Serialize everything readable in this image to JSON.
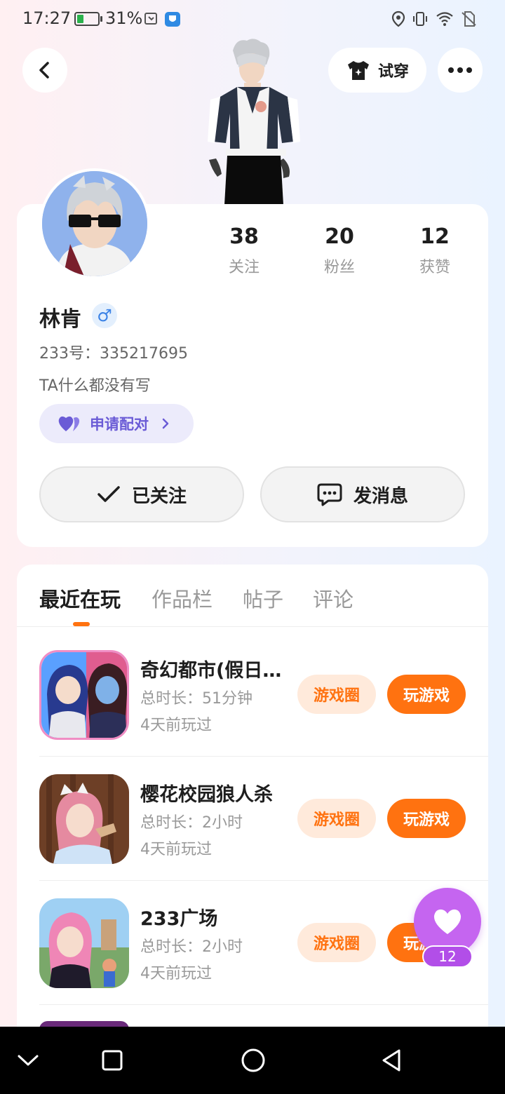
{
  "status_bar": {
    "time": "17:27",
    "battery_percent": "31%",
    "battery_level": 0.31
  },
  "header": {
    "try_on_label": "试穿"
  },
  "profile": {
    "stats": [
      {
        "value": "38",
        "label": "关注"
      },
      {
        "value": "20",
        "label": "粉丝"
      },
      {
        "value": "12",
        "label": "获赞"
      }
    ],
    "name": "林肯",
    "gender_symbol": "♂",
    "user_id": "233号：335217695",
    "bio": "TA什么都没有写",
    "pair_label": "申请配对",
    "followed_label": "已关注",
    "message_label": "发消息"
  },
  "tabs": [
    "最近在玩",
    "作品栏",
    "帖子",
    "评论"
  ],
  "games": [
    {
      "title": "奇幻都市(假日…",
      "duration": "总时长：51分钟",
      "last_played": "4天前玩过",
      "circle_label": "游戏圈",
      "play_label": "玩游戏"
    },
    {
      "title": "樱花校园狼人杀",
      "duration": "总时长：2小时",
      "last_played": "4天前玩过",
      "circle_label": "游戏圈",
      "play_label": "玩游戏"
    },
    {
      "title": "233广场",
      "duration": "总时长：2小时",
      "last_played": "4天前玩过",
      "circle_label": "游戏圈",
      "play_label": "玩游戏"
    }
  ],
  "like_fab": {
    "count": "12"
  },
  "colors": {
    "accent_orange": "#ff7210",
    "pair_purple": "#6a5bd6",
    "like_purple": "#c565f0"
  }
}
